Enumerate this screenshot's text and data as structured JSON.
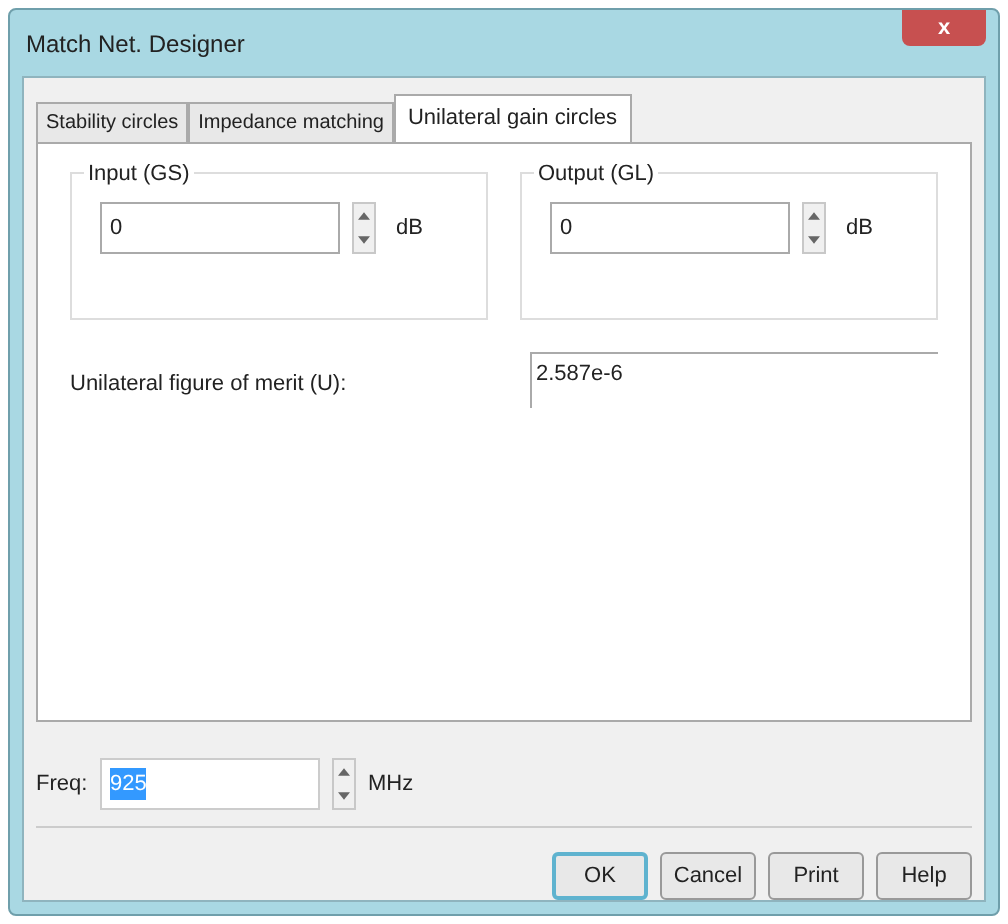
{
  "window": {
    "title": "Match Net. Designer",
    "close": "x"
  },
  "tabs": [
    {
      "label": "Stability circles",
      "selected": false
    },
    {
      "label": "Impedance matching",
      "selected": false
    },
    {
      "label": "Unilateral gain circles",
      "selected": true
    }
  ],
  "groups": [
    {
      "title": "Input (GS)",
      "value": "0",
      "unit": "dB"
    },
    {
      "title": "Output (GL)",
      "value": "0",
      "unit": "dB"
    }
  ],
  "figure_of_merit": {
    "label": "Unilateral figure of merit (U):",
    "value": "2.587e-6"
  },
  "freq": {
    "label": "Freq:",
    "value": "925",
    "unit": "MHz"
  },
  "buttons": [
    {
      "label": "OK",
      "default": true
    },
    {
      "label": "Cancel",
      "default": false
    },
    {
      "label": "Print",
      "default": false
    },
    {
      "label": "Help",
      "default": false
    }
  ]
}
